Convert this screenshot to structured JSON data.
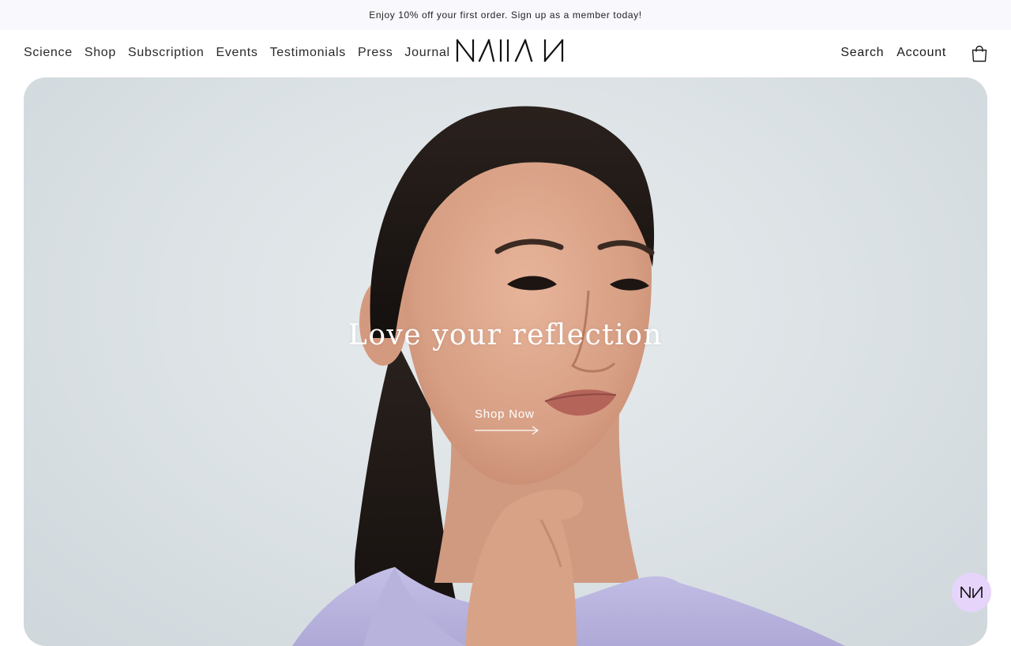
{
  "announcement": {
    "text": "Enjoy 10% off your first order. Sign up as a member today!"
  },
  "nav": {
    "items": [
      {
        "label": "Science"
      },
      {
        "label": "Shop"
      },
      {
        "label": "Subscription"
      },
      {
        "label": "Events"
      },
      {
        "label": "Testimonials"
      },
      {
        "label": "Press"
      },
      {
        "label": "Journal"
      }
    ],
    "search_label": "Search",
    "account_label": "Account"
  },
  "brand": {
    "logo_icon": "naman-wordmark-logo"
  },
  "hero": {
    "title": "Love your reflection",
    "cta_label": "Shop Now",
    "image": "woman-portrait-lavender-top"
  },
  "icons": {
    "cart": "shopping-bag-icon",
    "chat": "chat-launcher-icon"
  },
  "colors": {
    "announcement_bg": "#f8f8fd",
    "chat_bubble": "#e6d4fb",
    "hero_bg": "#dde3e6",
    "top_lavender": "#b7b3dc"
  }
}
